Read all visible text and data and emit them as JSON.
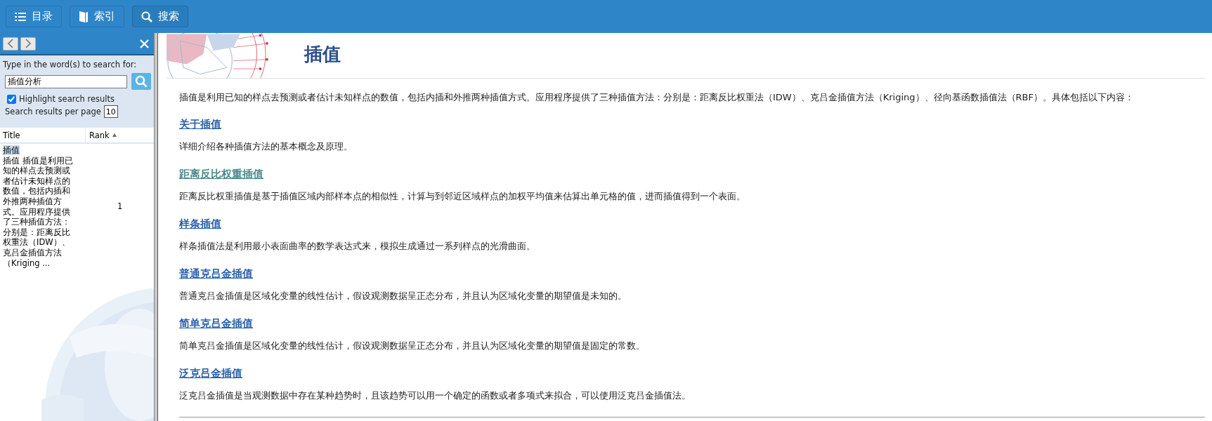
{
  "toolbar": [
    {
      "label": "目录",
      "kind": "contents",
      "selected": false
    },
    {
      "label": "索引",
      "kind": "index",
      "selected": false
    },
    {
      "label": "搜索",
      "kind": "search",
      "selected": true
    }
  ],
  "search_panel": {
    "prompt": "Type in the word(s) to search for:",
    "query": "插值分析",
    "highlight": {
      "label": "Highlight search results",
      "checked": true
    },
    "per_page": {
      "label": "Search results per page",
      "value": "10"
    }
  },
  "results": {
    "columns": [
      "Title",
      "Rank"
    ],
    "rows": [
      {
        "title": "插值",
        "excerpt": "插值 插值是利用已知的样点去预测或者估计未知样点的数值，包括内插和外推两种插值方式。应用程序提供了三种插值方法：分别是：距离反比权重法（IDW）、克吕金插值方法（Kriging ...",
        "rank": "1",
        "selected": false
      }
    ]
  },
  "article": {
    "title": "插值",
    "intro": "插值是利用已知的样点去预测或者估计未知样点的数值，包括内插和外推两种插值方式。应用程序提供了三种插值方法：分别是：距离反比权重法（IDW）、克吕金插值方法（Kriging）、径向基函数插值法（RBF）。具体包括以下内容：",
    "sections": [
      {
        "link": "关于插值",
        "visited": false,
        "text": "详细介绍各种插值方法的基本概念及原理。"
      },
      {
        "link": "距离反比权重插值",
        "visited": true,
        "text": "距离反比权重插值是基于插值区域内部样本点的相似性，计算与到邻近区域样点的加权平均值来估算出单元格的值，进而插值得到一个表面。"
      },
      {
        "link": "样条插值",
        "visited": false,
        "text": "样条插值法是利用最小表面曲率的数学表达式来，模拟生成通过一系列样点的光滑曲面。"
      },
      {
        "link": "普通克吕金插值",
        "visited": false,
        "text": "普通克吕金插值是区域化变量的线性估计，假设观测数据呈正态分布，并且认为区域化变量的期望值是未知的。"
      },
      {
        "link": "简单克吕金插值",
        "visited": false,
        "text": "简单克吕金插值是区域化变量的线性估计，假设观测数据呈正态分布，并且认为区域化变量的期望值是固定的常数。"
      },
      {
        "link": "泛克吕金插值",
        "visited": false,
        "text": "泛克吕金插值是当观测数据中存在某种趋势时，且该趋势可以用一个确定的函数或者多项式来拟合，可以使用泛克吕金插值法。"
      }
    ]
  }
}
